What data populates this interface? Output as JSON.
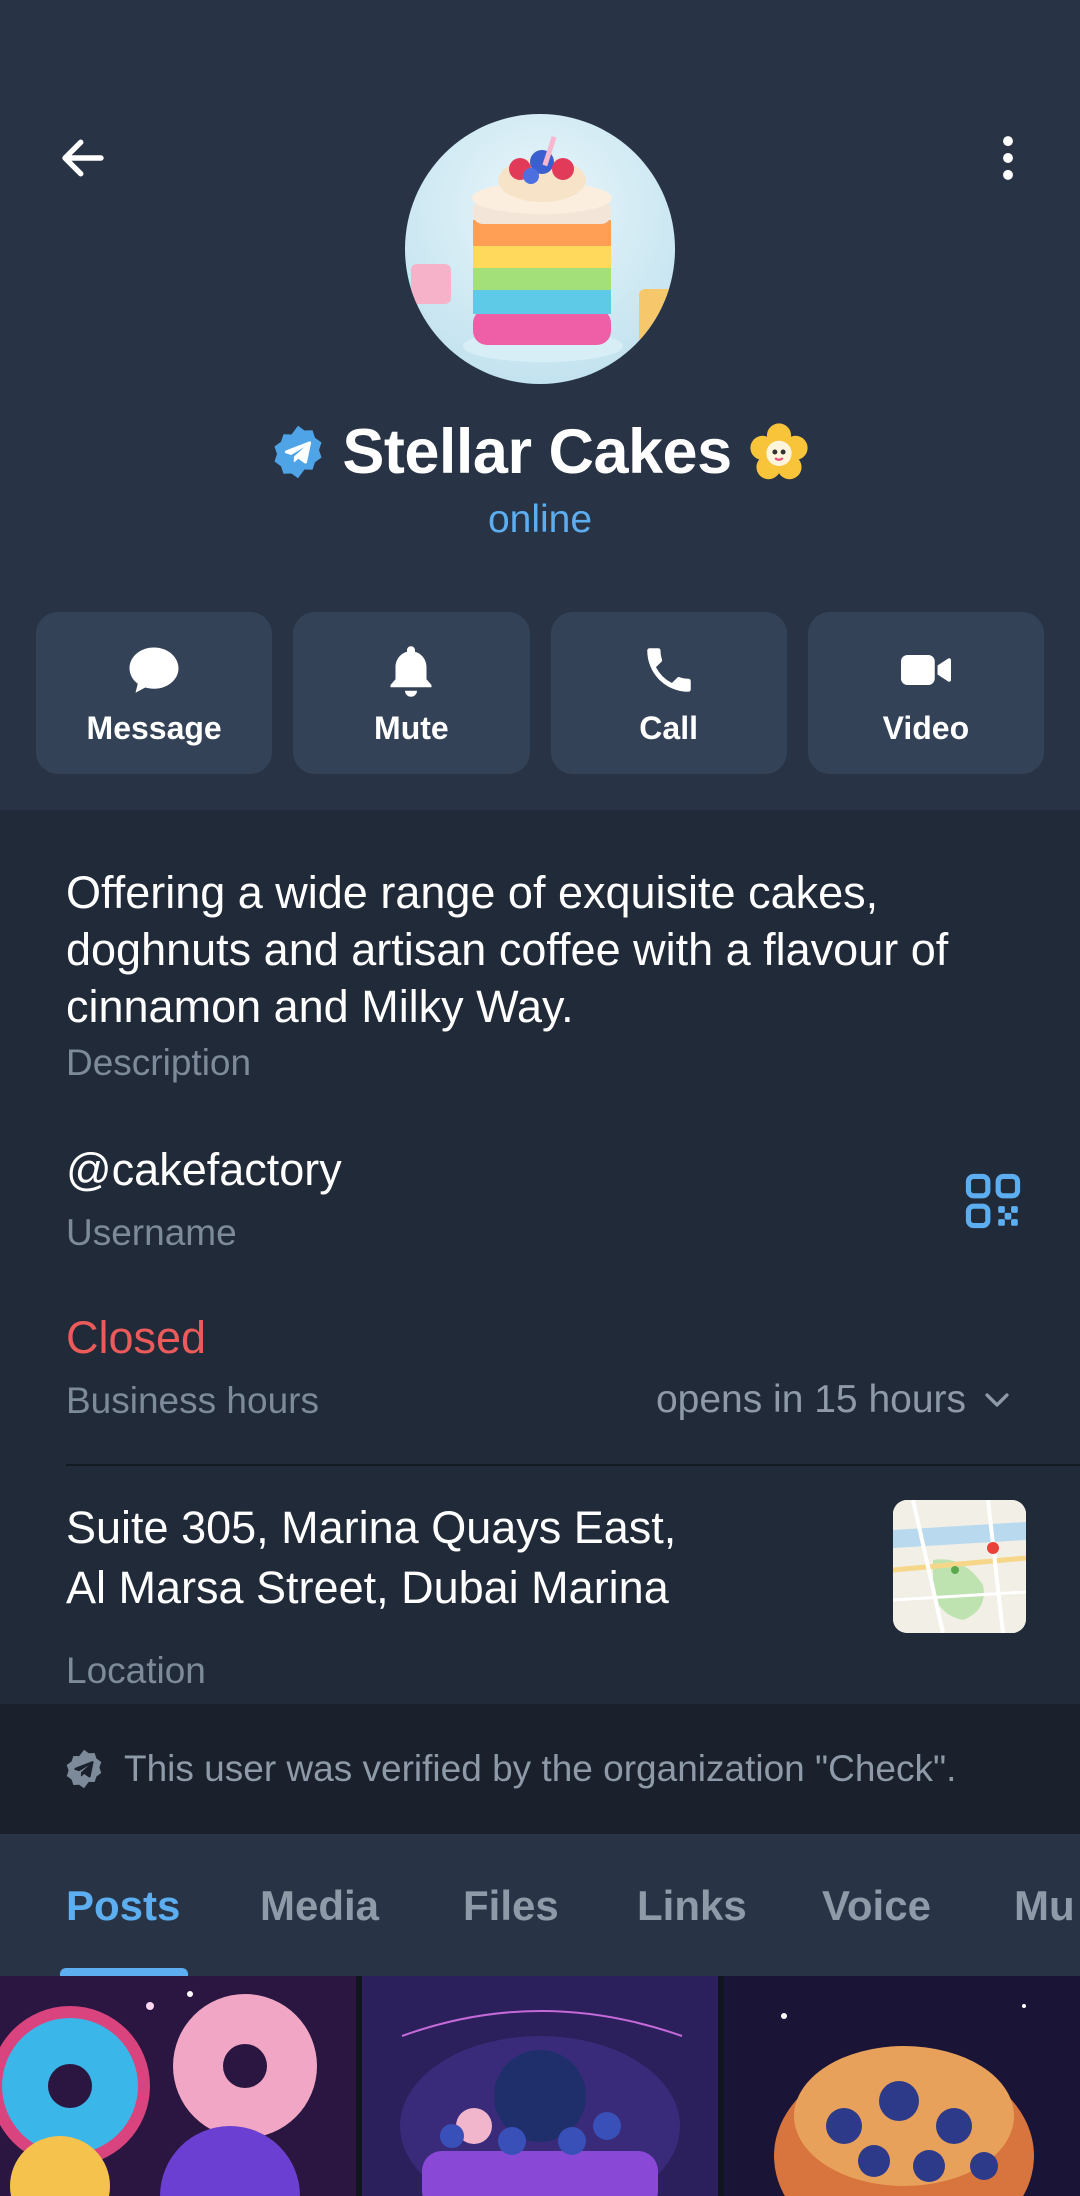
{
  "header": {
    "back_icon": "arrow-left-icon",
    "more_icon": "more-vertical-icon"
  },
  "profile": {
    "name": "Stellar Cakes",
    "status": "online",
    "verified_icon": "verified-badge-icon",
    "emoji_status_icon": "flower-emoji-icon",
    "accent_color": "#5caef0"
  },
  "actions": [
    {
      "label": "Message",
      "icon": "chat-bubble-icon"
    },
    {
      "label": "Mute",
      "icon": "bell-icon"
    },
    {
      "label": "Call",
      "icon": "phone-icon"
    },
    {
      "label": "Video",
      "icon": "video-camera-icon"
    }
  ],
  "info": {
    "description": "Offering a wide range of exquisite cakes, doghnuts and artisan coffee with a flavour of cinnamon and Milky Way.",
    "description_label": "Description",
    "username": "@cakefactory",
    "username_label": "Username",
    "business_status": "Closed",
    "business_status_color": "#ec5a5a",
    "business_hours_label": "Business hours",
    "opens_text": "opens in 15 hours",
    "location_line1": "Suite 305, Marina Quays East,",
    "location_line2": "Al Marsa Street, Dubai Marina",
    "location_label": "Location"
  },
  "verification": {
    "text": "This user was verified by the organization \"Check\"."
  },
  "tabs": [
    {
      "label": "Posts",
      "active": true
    },
    {
      "label": "Media",
      "active": false
    },
    {
      "label": "Files",
      "active": false
    },
    {
      "label": "Links",
      "active": false
    },
    {
      "label": "Voice",
      "active": false
    },
    {
      "label": "Mu",
      "active": false
    }
  ]
}
